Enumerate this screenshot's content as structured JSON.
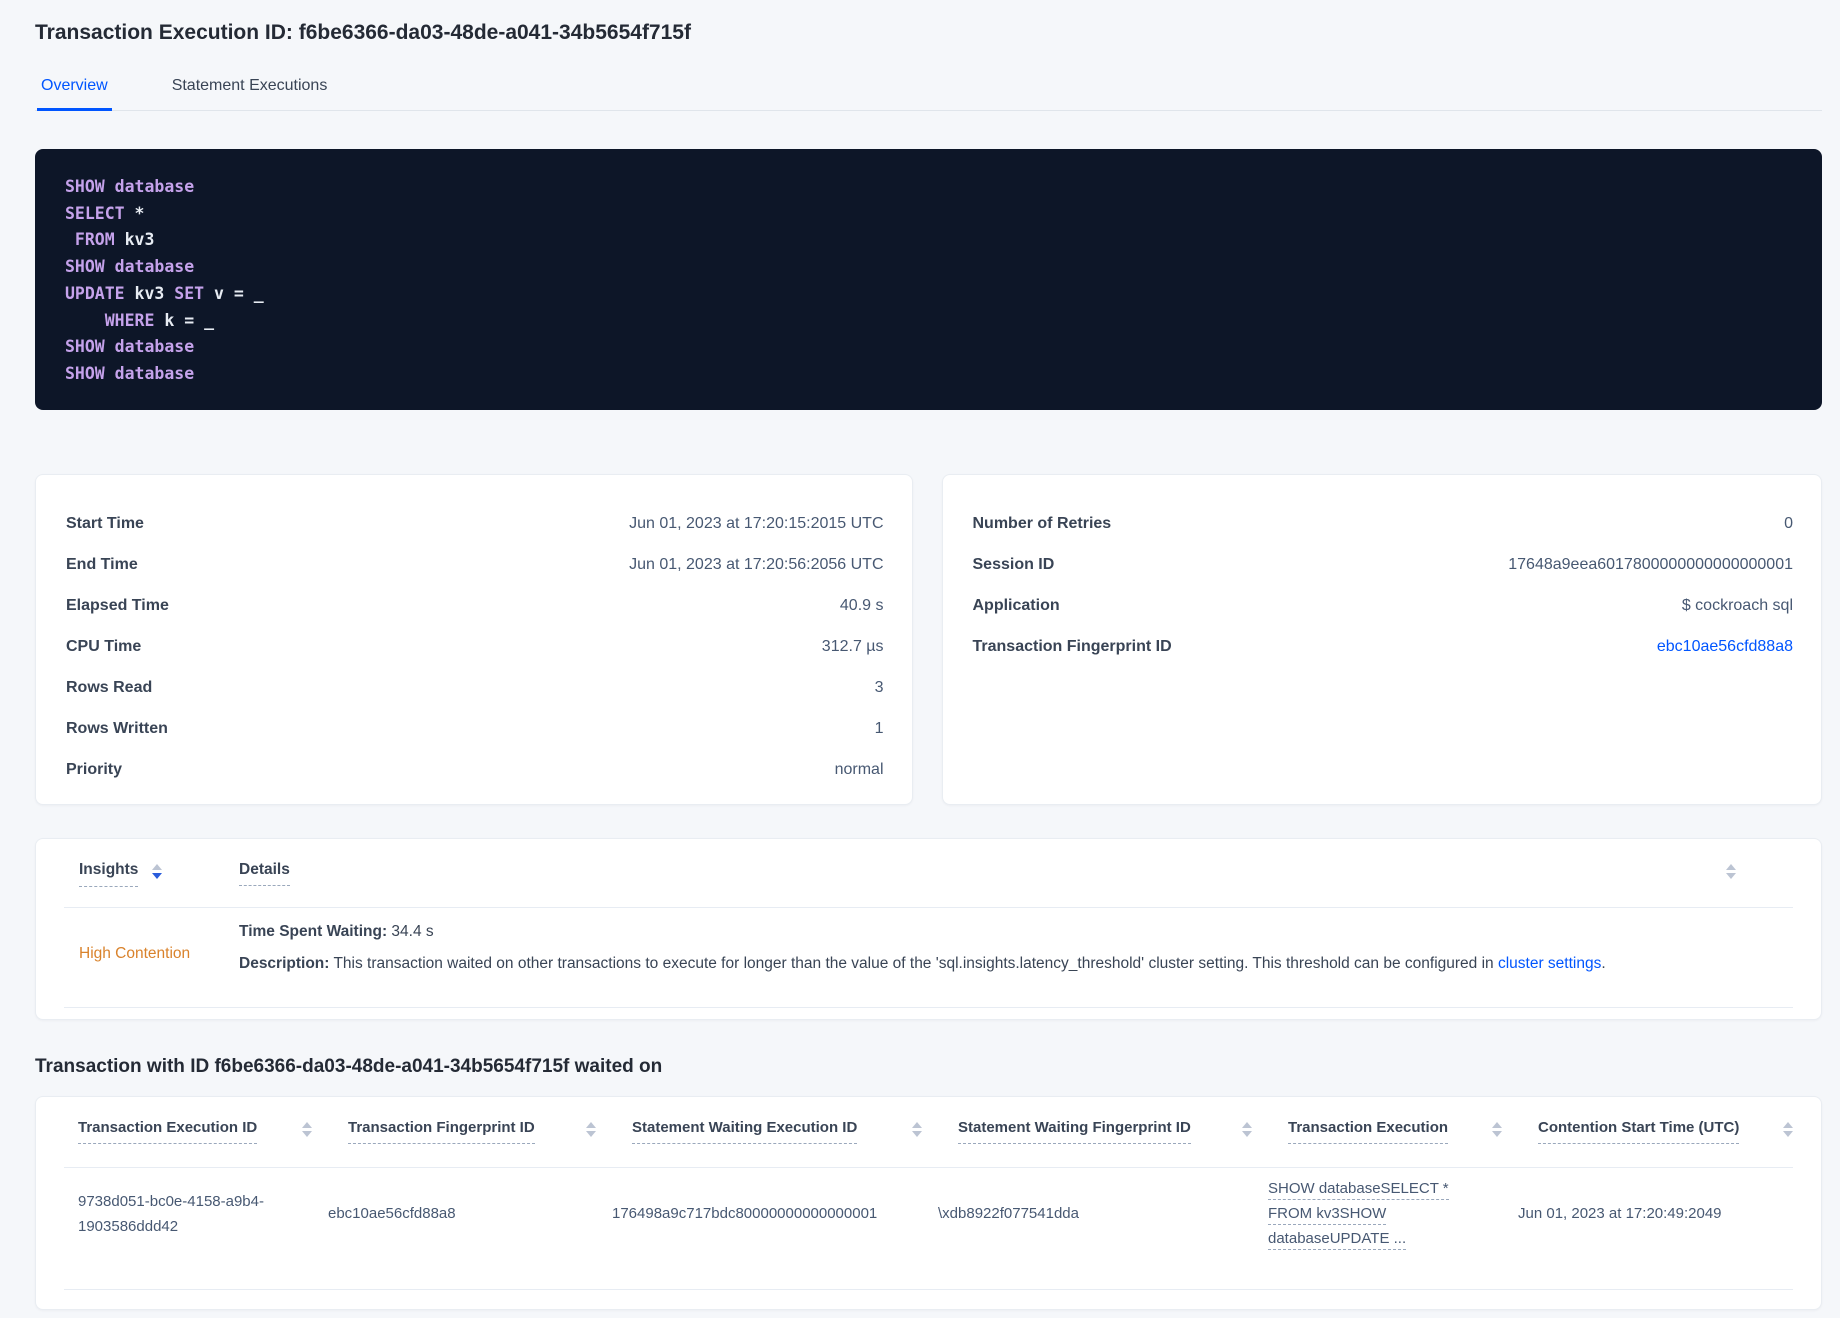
{
  "header": {
    "title": "Transaction Execution ID: f6be6366-da03-48de-a041-34b5654f715f"
  },
  "tabs": {
    "overview": "Overview",
    "statement_executions": "Statement Executions"
  },
  "sql_lines": [
    [
      {
        "t": "SHOW database"
      }
    ],
    [
      {
        "t": "SELECT"
      },
      {
        "t": " *"
      }
    ],
    [
      {
        "t": " FROM"
      },
      {
        "t": " kv3"
      }
    ],
    [
      {
        "t": "SHOW database"
      }
    ],
    [
      {
        "t": "UPDATE"
      },
      {
        "t": " kv3 "
      },
      {
        "t": "SET"
      },
      {
        "t": " v = _"
      }
    ],
    [
      {
        "t": "    WHERE"
      },
      {
        "t": " k = _"
      }
    ],
    [
      {
        "t": "SHOW database"
      }
    ],
    [
      {
        "t": "SHOW database"
      }
    ]
  ],
  "summary_left": {
    "rows": [
      {
        "label": "Start Time",
        "value": "Jun 01, 2023 at 17:20:15:2015 UTC"
      },
      {
        "label": "End Time",
        "value": "Jun 01, 2023 at 17:20:56:2056 UTC"
      },
      {
        "label": "Elapsed Time",
        "value": "40.9 s"
      },
      {
        "label": "CPU Time",
        "value": "312.7 µs"
      },
      {
        "label": "Rows Read",
        "value": "3"
      },
      {
        "label": "Rows Written",
        "value": "1"
      },
      {
        "label": "Priority",
        "value": "normal"
      }
    ]
  },
  "summary_right": {
    "rows": [
      {
        "label": "Number of Retries",
        "value": "0"
      },
      {
        "label": "Session ID",
        "value": "17648a9eea6017800000000000000001"
      },
      {
        "label": "Application",
        "value": "$ cockroach sql"
      },
      {
        "label": "Transaction Fingerprint ID",
        "value": "ebc10ae56cfd88a8"
      }
    ]
  },
  "insights": {
    "col_insights": "Insights",
    "col_details": "Details",
    "type": "High Contention",
    "waiting_label": "Time Spent Waiting:",
    "waiting_value": " 34.4 s",
    "desc_label": "Description:",
    "desc_text": " This transaction waited on other transactions to execute for longer than the value of the 'sql.insights.latency_threshold' cluster setting. This threshold can be configured in ",
    "desc_link": "cluster settings",
    "desc_end": "."
  },
  "waited_section": {
    "heading": "Transaction with ID f6be6366-da03-48de-a041-34b5654f715f waited on",
    "columns": [
      "Transaction Execution ID",
      "Transaction Fingerprint ID",
      "Statement Waiting Execution ID",
      "Statement Waiting Fingerprint ID",
      "Transaction Execution",
      "Contention Start Time (UTC)"
    ],
    "row": {
      "txn_exec_id": "9738d051-bc0e-4158-a9b4-1903586ddd42",
      "txn_fingerprint_id": "ebc10ae56cfd88a8",
      "stmt_waiting_exec_id": "176498a9c717bdc80000000000000001",
      "stmt_waiting_fingerprint_id": "\\xdb8922f077541dda",
      "txn_exec_lines": [
        "SHOW databaseSELECT *",
        "FROM kv3SHOW",
        "databaseUPDATE ..."
      ],
      "contention_start": "Jun 01, 2023 at 17:20:49:2049"
    }
  },
  "colors": {
    "accent_blue": "#0055ff",
    "warning_orange": "#d9822b",
    "code_keyword_purple": "#c5a2eb",
    "code_background": "#0d1628",
    "page_background": "#f5f7fa"
  }
}
